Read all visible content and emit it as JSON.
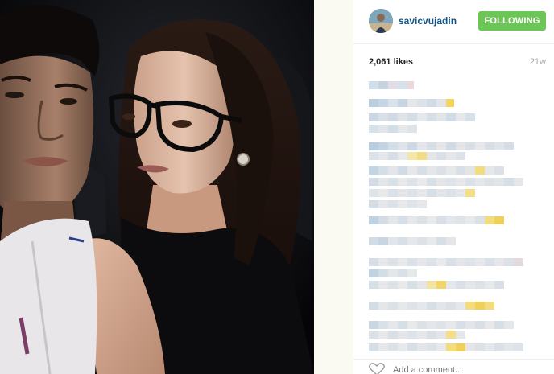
{
  "post": {
    "username": "savicvujadin",
    "follow_label": "FOLLOWING",
    "likes": "2,061 likes",
    "age": "21w",
    "add_comment_placeholder": "Add a comment...",
    "caption_redacted": true
  },
  "colors": {
    "accent_green": "#6cc655",
    "username_blue": "#125688"
  },
  "icons": {
    "like": "heart-outline-icon"
  }
}
